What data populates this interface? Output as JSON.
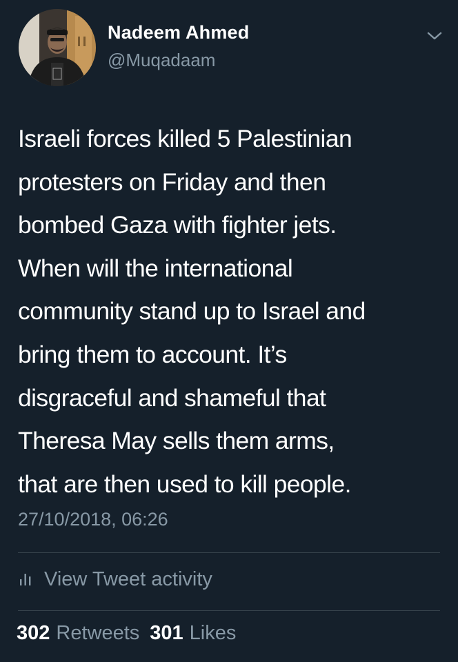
{
  "user": {
    "name": "Nadeem Ahmed",
    "handle": "@Muqadaam"
  },
  "tweet": {
    "lines": [
      "Israeli forces killed 5 Palestinian",
      "protesters on Friday and then",
      "bombed Gaza with fighter jets.",
      "When will the international",
      "community stand up to Israel and",
      "bring them to account. It’s",
      "disgraceful and shameful that",
      "Theresa May sells them arms,",
      "that are then used to kill people."
    ],
    "timestamp": "27/10/2018, 06:26"
  },
  "activity": {
    "label": "View Tweet activity",
    "icon": "bar-chart-icon"
  },
  "stats": {
    "retweets_count": "302",
    "retweets_label": "Retweets",
    "likes_count": "301",
    "likes_label": "Likes"
  },
  "colors": {
    "background": "#15202b",
    "primary_text": "#ffffff",
    "secondary_text": "#8899a6",
    "divider": "#38444d"
  }
}
